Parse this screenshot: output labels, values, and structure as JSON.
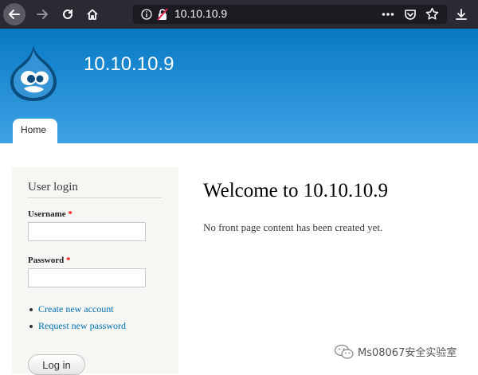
{
  "browser": {
    "url": "10.10.10.9",
    "icons": [
      "back-icon",
      "forward-icon",
      "reload-icon",
      "home-icon",
      "info-icon",
      "insecure-lock-icon",
      "more-icon",
      "pocket-icon",
      "bookmark-star-icon",
      "download-icon"
    ]
  },
  "site": {
    "name": "10.10.10.9",
    "tabs": [
      {
        "label": "Home"
      }
    ]
  },
  "login": {
    "title": "User login",
    "username_label": "Username",
    "password_label": "Password",
    "required_marker": "*",
    "username_value": "",
    "password_value": "",
    "links": [
      "Create new account",
      "Request new password"
    ],
    "submit_label": "Log in"
  },
  "main": {
    "title": "Welcome to 10.10.10.9",
    "text": "No front page content has been created yet."
  },
  "watermark": {
    "text": "Ms08067安全实验室"
  },
  "colors": {
    "toolbar": "#2b2a33",
    "urlbar": "#1c1b22",
    "header_top": "#0679c4",
    "header_bottom": "#3fa3e5",
    "sidebar": "#f6f6f2",
    "link": "#0071b3",
    "required": "#ee0000"
  }
}
